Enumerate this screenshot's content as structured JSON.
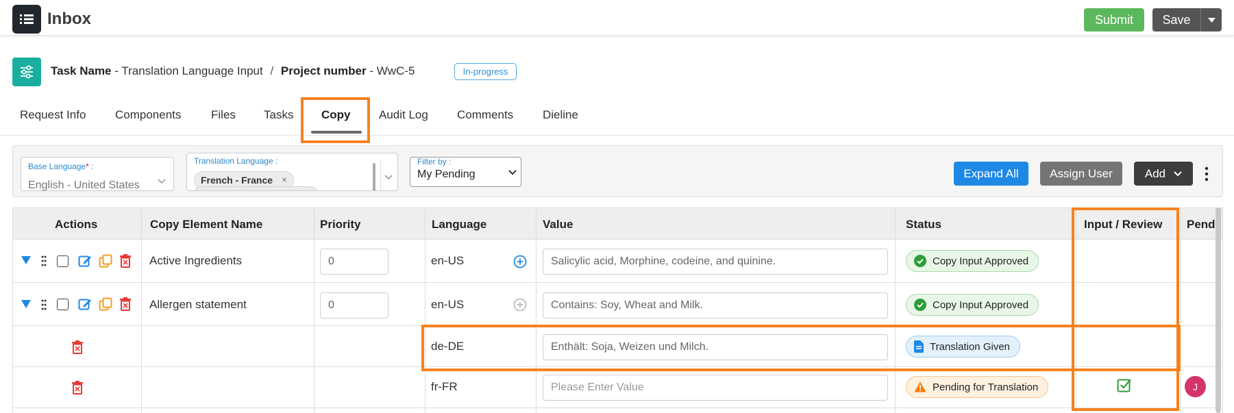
{
  "header": {
    "title": "Inbox",
    "submit_label": "Submit",
    "save_label": "Save"
  },
  "task": {
    "task_name_label": "Task Name",
    "task_name": "Translation Language Input",
    "separator": "/",
    "project_label": "Project number",
    "project_number": "WwC-5",
    "dash": "-",
    "status": "In-progress"
  },
  "tabs": [
    "Request Info",
    "Components",
    "Files",
    "Tasks",
    "Copy",
    "Audit Log",
    "Comments",
    "Dieline"
  ],
  "active_tab": "Copy",
  "filters": {
    "base_language_label": "Base Language",
    "base_language_required": "*",
    "base_language_colon": ":",
    "base_language_value": "English - United States",
    "translation_language_label": "Translation Language :",
    "translation_chip": "French - France",
    "chip_remove": "×",
    "filter_by_label": "Filter by :",
    "filter_by_value": "My Pending"
  },
  "toolbar": {
    "expand_all": "Expand All",
    "assign_user": "Assign User",
    "add": "Add"
  },
  "table": {
    "headers": [
      "Actions",
      "Copy Element Name",
      "Priority",
      "Language",
      "Value",
      "Status",
      "Input / Review",
      "Pend"
    ],
    "rows": [
      {
        "name": "Active Ingredients",
        "priority": "0",
        "language": "en-US",
        "value": "Salicylic acid, Morphine, codeine, and quinine.",
        "status": "Copy Input Approved"
      },
      {
        "name": "Allergen statement",
        "priority": "0",
        "language": "en-US",
        "value": "Contains: Soy, Wheat and Milk.",
        "status": "Copy Input Approved"
      },
      {
        "name": "",
        "priority": "",
        "language": "de-DE",
        "value": "Enthält: Soja, Weizen und Milch.",
        "status": "Translation Given"
      },
      {
        "name": "",
        "priority": "",
        "language": "fr-FR",
        "value_placeholder": "Please Enter Value",
        "status": "Pending for Translation",
        "pending_user_initial": "J"
      }
    ]
  },
  "colors": {
    "submit": "#5cb85c",
    "save": "#555555",
    "accent_teal": "#1aaea0",
    "expand_all": "#1e88e5",
    "highlight": "#f5821f",
    "delete_red": "#e53935",
    "edit_blue": "#1e88e5",
    "copy_orange": "#f0a020"
  }
}
